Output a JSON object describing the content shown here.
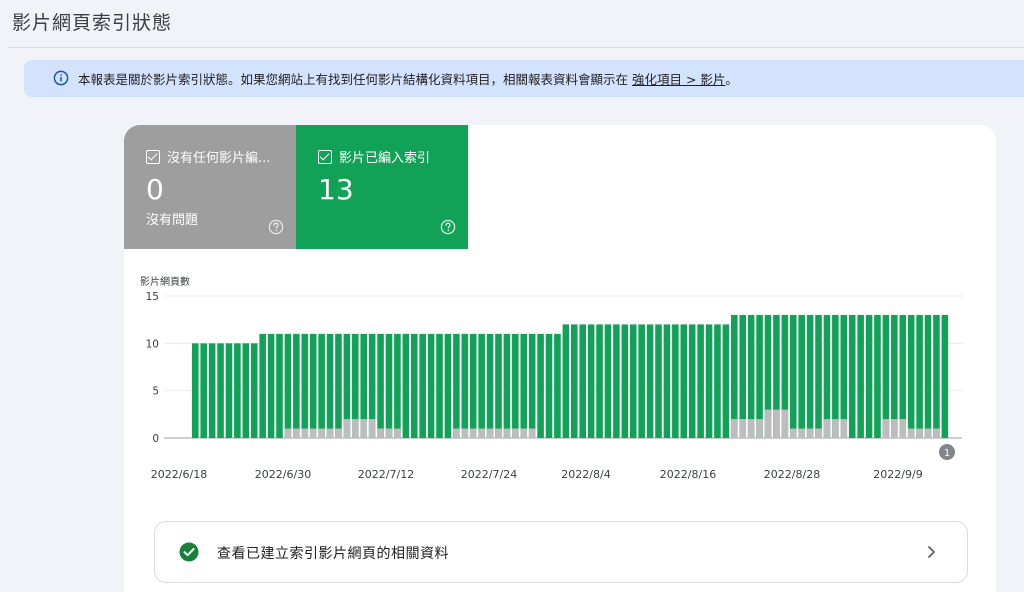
{
  "page": {
    "title": "影片網頁索引狀態"
  },
  "banner": {
    "text": "本報表是關於影片索引狀態。如果您網站上有找到任何影片結構化資料項目，相關報表資料會顯示在",
    "link": "強化項目 > 影片",
    "suffix": "。"
  },
  "tiles": [
    {
      "label": "沒有任何影片編...",
      "value": "0",
      "sub": "沒有問題",
      "color": "#9e9e9e"
    },
    {
      "label": "影片已編入索引",
      "value": "13",
      "sub": "",
      "color": "#12a257"
    }
  ],
  "footer": {
    "text": "查看已建立索引影片網頁的相關資料"
  },
  "chart_data": {
    "type": "bar",
    "stacked": false,
    "ylabel": "影片網頁數",
    "ylim": [
      0,
      15
    ],
    "yticks": [
      0,
      5,
      10,
      15
    ],
    "xtick_labels": [
      "2022/6/18",
      "2022/6/30",
      "2022/7/12",
      "2022/7/24",
      "2022/8/4",
      "2022/8/16",
      "2022/8/28",
      "2022/9/9"
    ],
    "annotation": "1",
    "series": [
      {
        "color": "#12a257",
        "values": [
          10,
          10,
          10,
          10,
          10,
          10,
          10,
          10,
          11,
          11,
          11,
          11,
          11,
          11,
          11,
          11,
          11,
          11,
          11,
          11,
          11,
          11,
          11,
          11,
          11,
          11,
          11,
          11,
          11,
          11,
          11,
          11,
          11,
          11,
          11,
          11,
          11,
          11,
          11,
          11,
          11,
          11,
          11,
          11,
          12,
          12,
          12,
          12,
          12,
          12,
          12,
          12,
          12,
          12,
          12,
          12,
          12,
          12,
          12,
          12,
          12,
          12,
          12,
          12,
          13,
          13,
          13,
          13,
          13,
          13,
          13,
          13,
          13,
          13,
          13,
          13,
          13,
          13,
          13,
          13,
          13,
          13,
          13,
          13,
          13,
          13,
          13,
          13,
          13,
          13
        ]
      },
      {
        "color": "#bdbdbd",
        "values": [
          0,
          0,
          0,
          0,
          0,
          0,
          0,
          0,
          0,
          0,
          0,
          1,
          1,
          1,
          1,
          1,
          1,
          1,
          2,
          2,
          2,
          2,
          1,
          1,
          1,
          0,
          0,
          0,
          0,
          0,
          0,
          1,
          1,
          1,
          1,
          1,
          1,
          1,
          1,
          1,
          1,
          0,
          0,
          0,
          0,
          0,
          0,
          0,
          0,
          0,
          0,
          0,
          0,
          0,
          0,
          0,
          0,
          0,
          0,
          0,
          0,
          0,
          0,
          0,
          2,
          2,
          2,
          2,
          3,
          3,
          3,
          1,
          1,
          1,
          1,
          2,
          2,
          2,
          0,
          0,
          0,
          0,
          2,
          2,
          2,
          1,
          1,
          1,
          1,
          0
        ]
      }
    ]
  }
}
